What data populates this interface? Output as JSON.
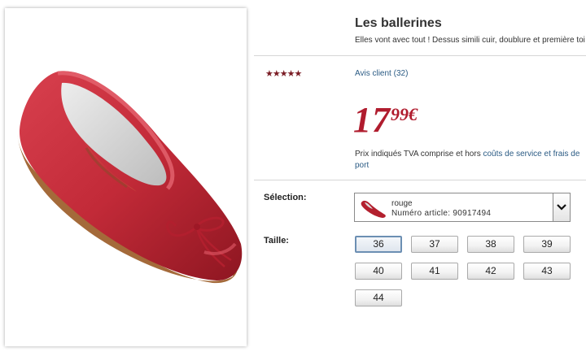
{
  "product": {
    "title": "Les ballerines",
    "subtitle": "Elles vont avec tout ! Dessus simili cuir, doublure et première toi",
    "image_icon": "red-ballerina-shoe"
  },
  "rating": {
    "stars": "★★★★★",
    "reviews_label": "Avis client (32)"
  },
  "price": {
    "integer": "17",
    "decimals": "99",
    "currency": "€"
  },
  "vat_note": {
    "text": "Prix indiqués TVA comprise et hors ",
    "link": "coûts de service et frais de port"
  },
  "selection": {
    "label": "Sélection:",
    "color": "rouge",
    "article_number": "Numéro article: 90917494"
  },
  "size": {
    "label": "Taille:",
    "options": [
      "36",
      "37",
      "38",
      "39",
      "40",
      "41",
      "42",
      "43",
      "44"
    ],
    "selected": "36"
  },
  "colors": {
    "price": "#b01c2e",
    "link": "#2b5b84",
    "stars": "#7a1c24"
  }
}
